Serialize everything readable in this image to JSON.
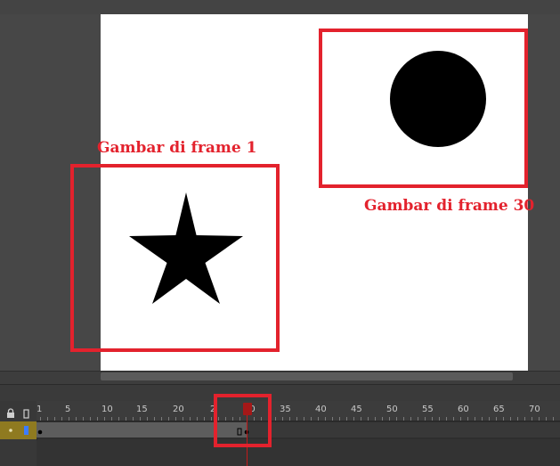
{
  "annotations": {
    "frame1_label": "Gambar di frame 1",
    "frame30_label": "Gambar di frame 30"
  },
  "timeline": {
    "frame_ticks": [
      "1",
      "5",
      "10",
      "15",
      "20",
      "2",
      "30",
      "35",
      "40",
      "45",
      "50",
      "55",
      "60",
      "65",
      "70"
    ],
    "current_frame": 30
  },
  "colors": {
    "highlight": "#e3222d",
    "layer_active": "#8f7a20",
    "playhead": "#c21b1b"
  },
  "icons": [
    "lock-icon",
    "frame-outline-icon",
    "visibility-dot-icon",
    "layer-color-icon",
    "keyframe-icon"
  ]
}
